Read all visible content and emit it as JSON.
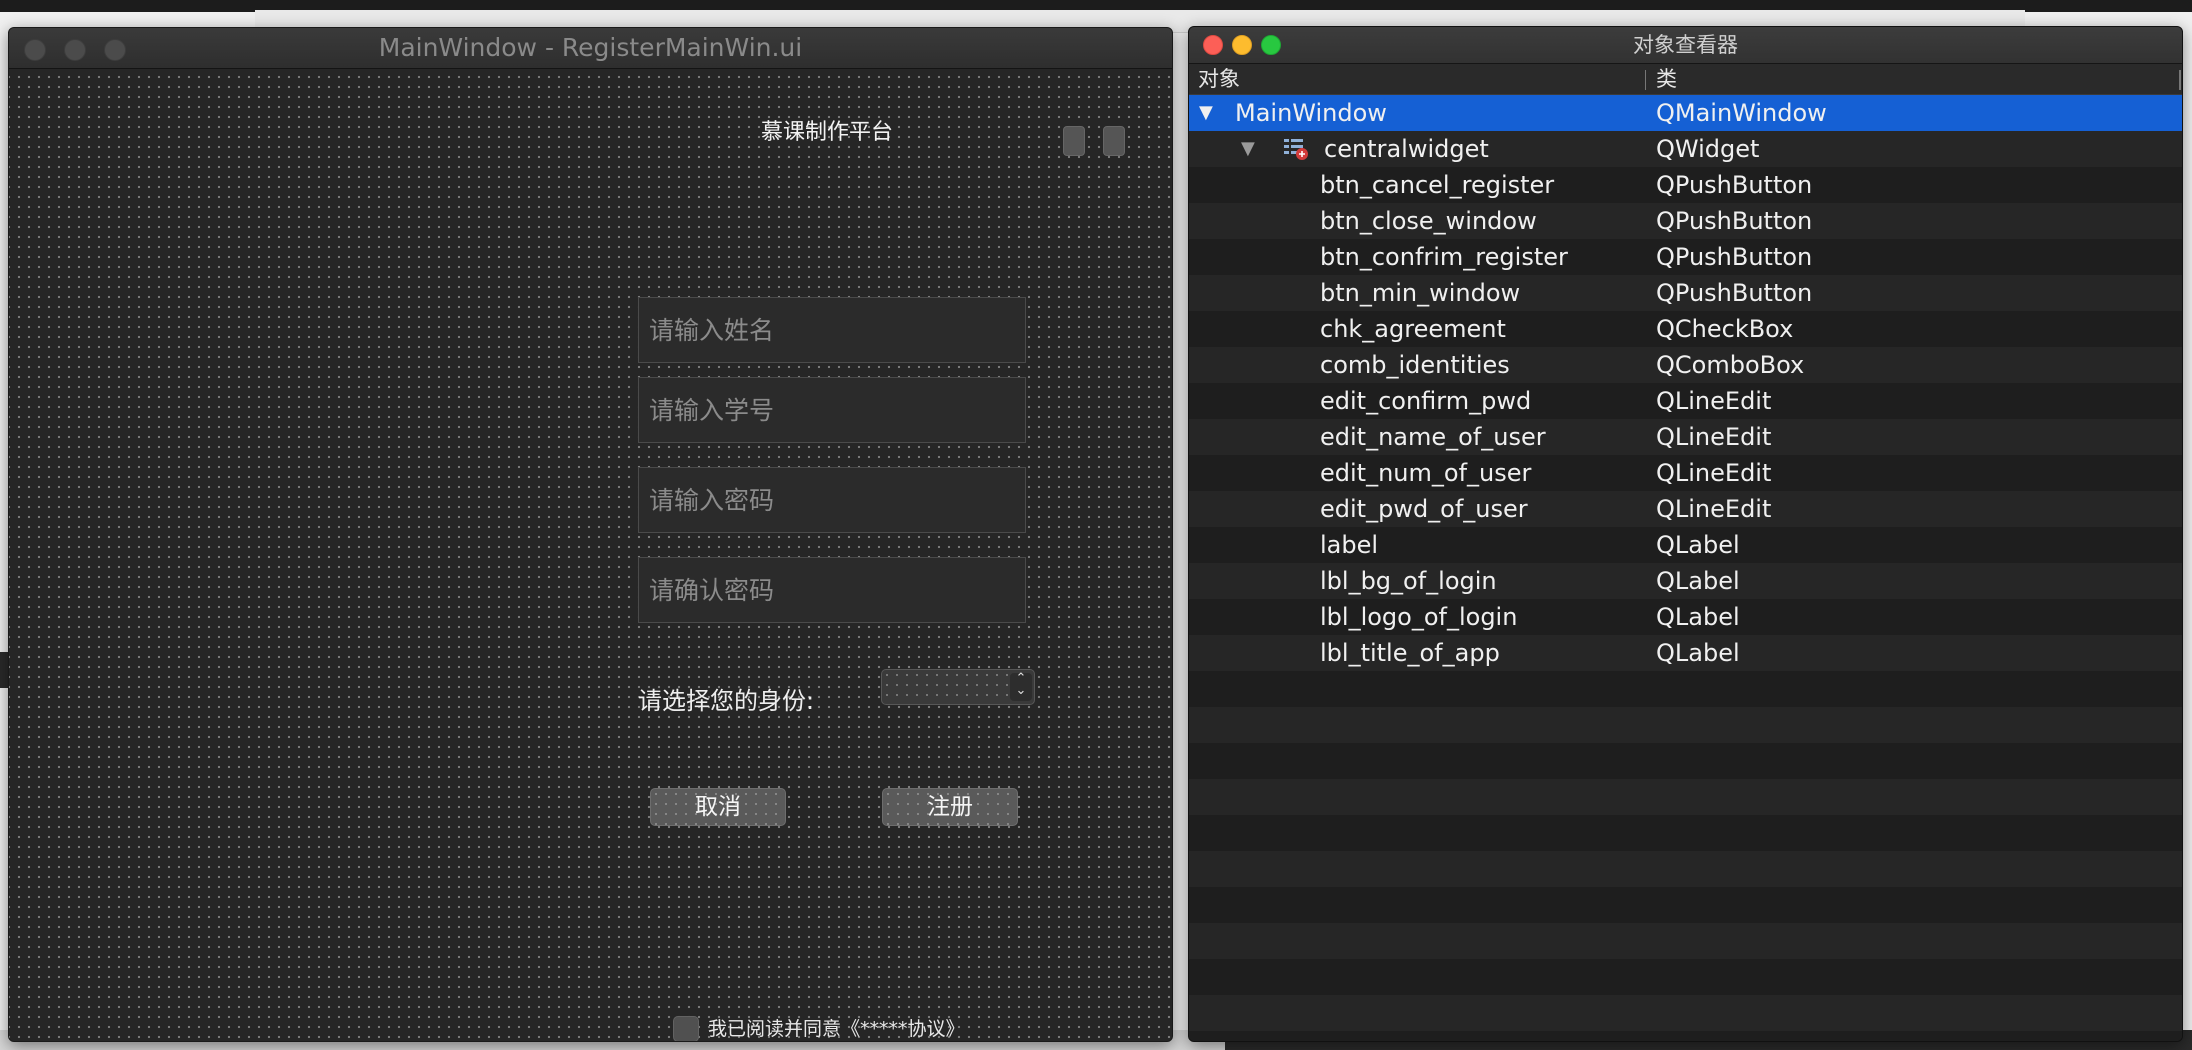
{
  "form_window": {
    "title": "MainWindow - RegisterMainWin.ui",
    "app_title": "慕课制作平台",
    "fields": [
      {
        "placeholder": "请输入姓名"
      },
      {
        "placeholder": "请输入学号"
      },
      {
        "placeholder": "请输入密码"
      },
      {
        "placeholder": "请确认密码"
      }
    ],
    "identity_label": "请选择您的身份:",
    "cancel_label": "取消",
    "register_label": "注册",
    "agreement_label": "我已阅读并同意《*****协议》"
  },
  "inspector": {
    "title": "对象查看器",
    "col_object": "对象",
    "col_class": "类",
    "root": {
      "name": "MainWindow",
      "class": "QMainWindow"
    },
    "central": {
      "name": "centralwidget",
      "class": "QWidget"
    },
    "children": [
      {
        "name": "btn_cancel_register",
        "class": "QPushButton"
      },
      {
        "name": "btn_close_window",
        "class": "QPushButton"
      },
      {
        "name": "btn_confrim_register",
        "class": "QPushButton"
      },
      {
        "name": "btn_min_window",
        "class": "QPushButton"
      },
      {
        "name": "chk_agreement",
        "class": "QCheckBox"
      },
      {
        "name": "comb_identities",
        "class": "QComboBox"
      },
      {
        "name": "edit_confirm_pwd",
        "class": "QLineEdit"
      },
      {
        "name": "edit_name_of_user",
        "class": "QLineEdit"
      },
      {
        "name": "edit_num_of_user",
        "class": "QLineEdit"
      },
      {
        "name": "edit_pwd_of_user",
        "class": "QLineEdit"
      },
      {
        "name": "label",
        "class": "QLabel"
      },
      {
        "name": "lbl_bg_of_login",
        "class": "QLabel"
      },
      {
        "name": "lbl_logo_of_login",
        "class": "QLabel"
      },
      {
        "name": "lbl_title_of_app",
        "class": "QLabel"
      }
    ]
  },
  "colors": {
    "selection": "#1560d4",
    "close": "#fc5f57",
    "minimize": "#fdbc2e",
    "zoom": "#28c840"
  }
}
